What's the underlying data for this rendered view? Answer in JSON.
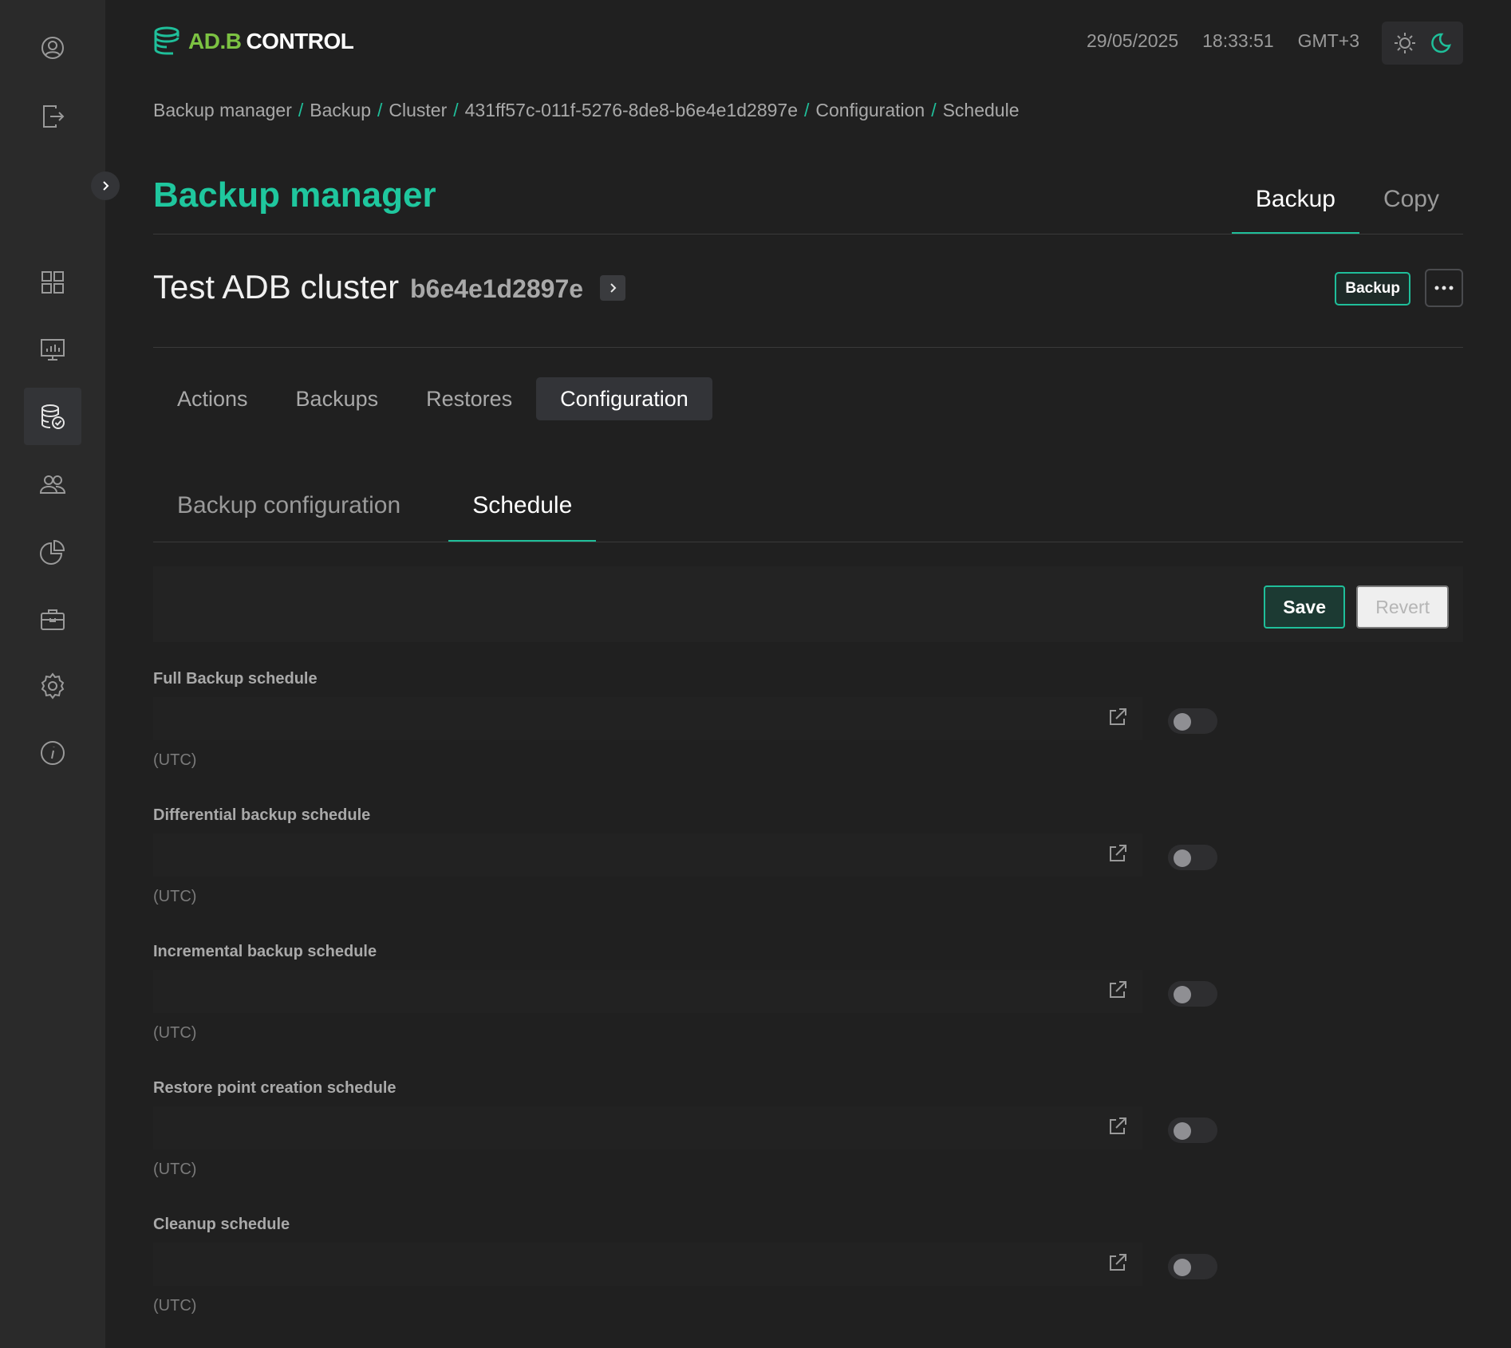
{
  "header": {
    "logo_green": "AD.B",
    "logo_white": "CONTROL",
    "date": "29/05/2025",
    "time": "18:33:51",
    "timezone": "GMT+3"
  },
  "breadcrumb": [
    "Backup manager",
    "Backup",
    "Cluster",
    "431ff57c-011f-5276-8de8-b6e4e1d2897e",
    "Configuration",
    "Schedule"
  ],
  "page": {
    "title": "Backup manager",
    "tabs": [
      {
        "label": "Backup",
        "active": true
      },
      {
        "label": "Copy",
        "active": false
      }
    ]
  },
  "cluster": {
    "name": "Test ADB cluster",
    "id_suffix": "b6e4e1d2897e",
    "badge": "Backup"
  },
  "section_tabs": [
    {
      "label": "Actions",
      "active": false
    },
    {
      "label": "Backups",
      "active": false
    },
    {
      "label": "Restores",
      "active": false
    },
    {
      "label": "Configuration",
      "active": true
    }
  ],
  "config_tabs": [
    {
      "label": "Backup configuration",
      "active": false
    },
    {
      "label": "Schedule",
      "active": true
    }
  ],
  "actions": {
    "save_label": "Save",
    "revert_label": "Revert"
  },
  "schedules": [
    {
      "label": "Full Backup schedule",
      "value": "",
      "timezone": "(UTC)",
      "enabled": false
    },
    {
      "label": "Differential backup schedule",
      "value": "",
      "timezone": "(UTC)",
      "enabled": false
    },
    {
      "label": "Incremental backup schedule",
      "value": "",
      "timezone": "(UTC)",
      "enabled": false
    },
    {
      "label": "Restore point creation schedule",
      "value": "",
      "timezone": "(UTC)",
      "enabled": false
    },
    {
      "label": "Cleanup schedule",
      "value": "",
      "timezone": "(UTC)",
      "enabled": false
    }
  ],
  "colors": {
    "accent": "#1fbf9a",
    "logo_green": "#7cc242",
    "background": "#202020",
    "sidebar": "#2a2a2a"
  },
  "sidebar_icons": [
    "user-icon",
    "logout-icon",
    "dashboard-icon",
    "monitoring-icon",
    "backup-icon",
    "users-icon",
    "analytics-icon",
    "toolbox-icon",
    "settings-icon",
    "info-icon"
  ]
}
